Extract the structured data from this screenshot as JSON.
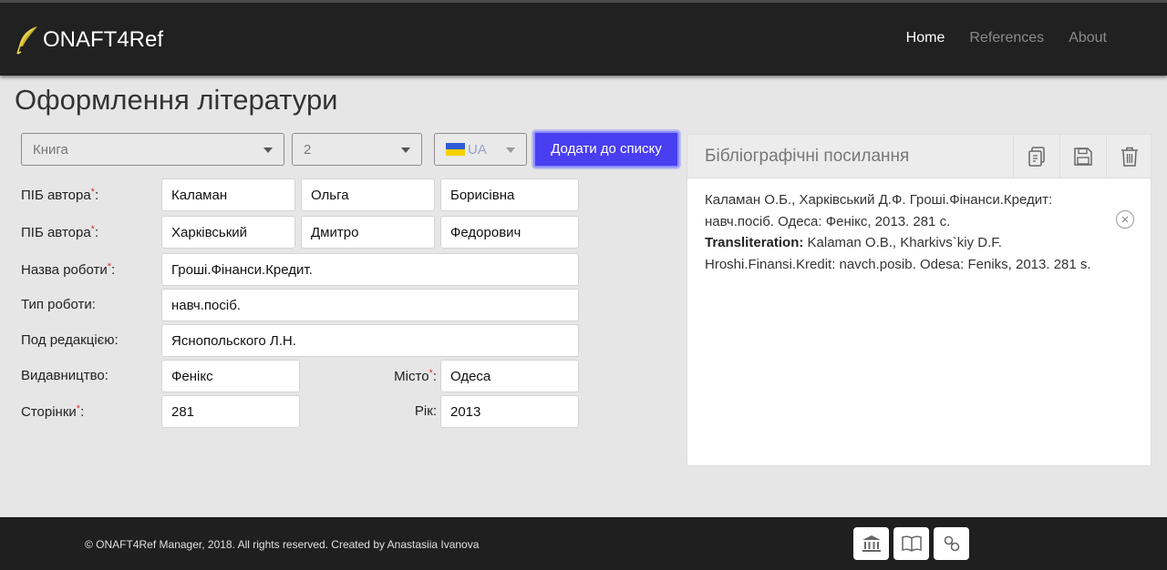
{
  "navbar": {
    "brand": "ONAFT4Ref",
    "links": [
      {
        "label": "Home",
        "active": true
      },
      {
        "label": "References",
        "active": false
      },
      {
        "label": "About",
        "active": false
      }
    ]
  },
  "page_title": "Оформлення літератури",
  "controls": {
    "type_select": "Книга",
    "count_select": "2",
    "lang_select": "UA",
    "add_button": "Додати до списку"
  },
  "form": {
    "required_mark": "*",
    "author1_label": "ПІБ автора",
    "author1": {
      "last": "Каламан",
      "first": "Ольга",
      "middle": "Борисівна"
    },
    "author2_label": "ПІБ автора",
    "author2": {
      "last": "Харківський",
      "first": "Дмитро",
      "middle": "Федорович"
    },
    "title_label": "Назва роботи",
    "title_value": "Гроші.Фінанси.Кредит.",
    "work_type_label": "Тип роботи:",
    "work_type_value": "навч.посіб.",
    "editor_label": "Под редакцією:",
    "editor_value": "Яснопольского Л.Н.",
    "publisher_label": "Видавництво:",
    "publisher_value": "Фенікс",
    "city_label": "Місто",
    "city_value": "Одеса",
    "pages_label": "Сторінки",
    "pages_value": "281",
    "year_label": "Рік:",
    "year_value": "2013"
  },
  "panel": {
    "title": "Бібліографічні посилання",
    "reference_line1": "Каламан О.Б., Харківський Д.Ф. Гроші.Фінанси.Кредит:",
    "reference_line2": "навч.посіб. Одеса: Фенікс, 2013. 281 с.",
    "translit_label": "Transliteration:",
    "translit_line1": " Kalaman O.B., Kharkivs`kiy D.F.",
    "translit_line2": "Hroshi.Finansi.Kredit: navch.posib. Odesa: Feniks, 2013. 281 s.",
    "icons": [
      "copy-doc-icon",
      "save-icon",
      "trash-icon",
      "close-circle-icon"
    ]
  },
  "footer": {
    "copyright": "© ONAFT4Ref Manager, 2018. All rights reserved. Created by Anastasiia Ivanova",
    "icons": [
      "bank-icon",
      "book-icon",
      "link-icon"
    ]
  },
  "colors": {
    "navbar": "#212121",
    "accent_button": "#4a3ff0",
    "required": "#e0332b",
    "background": "#e6e6e6"
  }
}
